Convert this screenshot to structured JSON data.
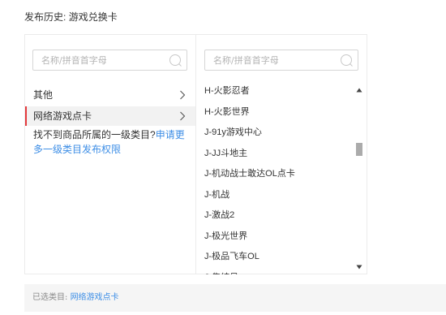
{
  "header": {
    "history_label": "发布历史:",
    "history_value": "游戏兑换卡"
  },
  "left_column": {
    "search_placeholder": "名称/拼音首字母",
    "categories": [
      {
        "label": "其他",
        "selected": false
      },
      {
        "label": "网络游戏点卡",
        "selected": true
      }
    ],
    "hint_text": "找不到商品所属的一级类目?",
    "hint_link": "申请更多一级类目发布权限"
  },
  "right_column": {
    "search_placeholder": "名称/拼音首字母",
    "items": [
      "H-火影忍者",
      "H-火影世界",
      "J-91y游戏中心",
      "J-JJ斗地主",
      "J-机动战士敢达OL点卡",
      "J-机战",
      "J-激战2",
      "J-极光世界",
      "J-极品飞车OL",
      "J-集结号"
    ],
    "scroll": {
      "position": 0.3,
      "visible_fraction": 0.08
    }
  },
  "footer": {
    "selected_label": "已选类目:",
    "selected_value": "网络游戏点卡"
  },
  "colors": {
    "accent_red": "#e4393c",
    "link_blue": "#3d8ee6"
  }
}
